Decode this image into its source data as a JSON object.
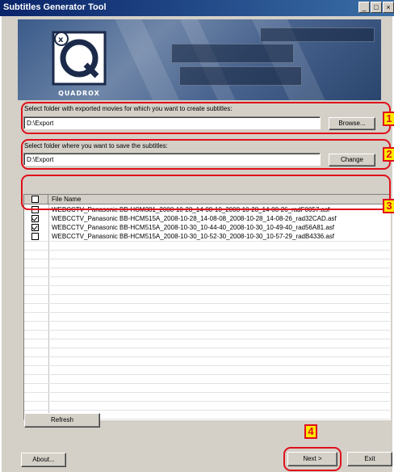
{
  "window": {
    "title": "Subtitles Generator Tool",
    "buttons": {
      "minimize": "_",
      "maximize": "□",
      "close": "×"
    }
  },
  "logo": {
    "text": "QUADROX"
  },
  "source": {
    "label": "Select folder with exported movies for which you want to create subtitles:",
    "value": "D:\\Export",
    "button": "Browse..."
  },
  "target": {
    "label": "Select folder where you want to save the subtitles:",
    "value": "D:\\Export",
    "button": "Change"
  },
  "files": {
    "header": "File Name",
    "rows": [
      {
        "name": "WEBCCTV_Panasonic BB-HCM381_2008-10-28_14-08-10_2008-10-28_14-08-26_radF0057.asf",
        "checked": false
      },
      {
        "name": "WEBCCTV_Panasonic BB-HCM515A_2008-10-28_14-08-08_2008-10-28_14-08-26_rad32CAD.asf",
        "checked": true
      },
      {
        "name": "WEBCCTV_Panasonic BB-HCM515A_2008-10-30_10-44-40_2008-10-30_10-49-40_rad56A81.asf",
        "checked": true
      },
      {
        "name": "WEBCCTV_Panasonic BB-HCM515A_2008-10-30_10-52-30_2008-10-30_10-57-29_radB4336.asf",
        "checked": false
      }
    ]
  },
  "buttons": {
    "refresh": "Refresh",
    "about": "About...",
    "next": "Next >",
    "exit": "Exit"
  },
  "callouts": [
    "1",
    "2",
    "3",
    "4"
  ],
  "colors": {
    "highlight": "#e0101a",
    "callout_fill": "#ffea00",
    "titlebar": "#0a246a"
  }
}
